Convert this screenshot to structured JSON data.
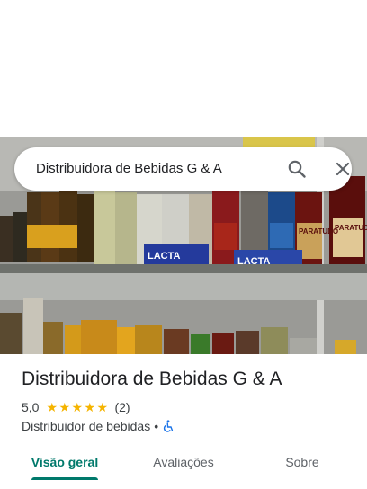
{
  "search": {
    "query": "Distribuidora de Bebidas G & A",
    "search_icon": "search-icon",
    "close_icon": "close-icon"
  },
  "photo": {
    "description_icon": "place-photo",
    "product_labels": [
      "LACTA",
      "LACTA",
      "PARATUDO",
      "PARATUDO",
      "KARIKOR"
    ]
  },
  "place": {
    "name": "Distribuidora de Bebidas G & A",
    "rating": "5,0",
    "stars": 5,
    "review_count": "(2)",
    "category": "Distribuidor de bebidas",
    "separator": "•",
    "accessibility_icon": "wheelchair-icon"
  },
  "tabs": [
    {
      "label": "Visão geral",
      "active": true
    },
    {
      "label": "Avaliações",
      "active": false
    },
    {
      "label": "Sobre",
      "active": false
    }
  ],
  "colors": {
    "accent": "#00796b",
    "star": "#f5b400",
    "accessibility": "#1a73e8"
  }
}
